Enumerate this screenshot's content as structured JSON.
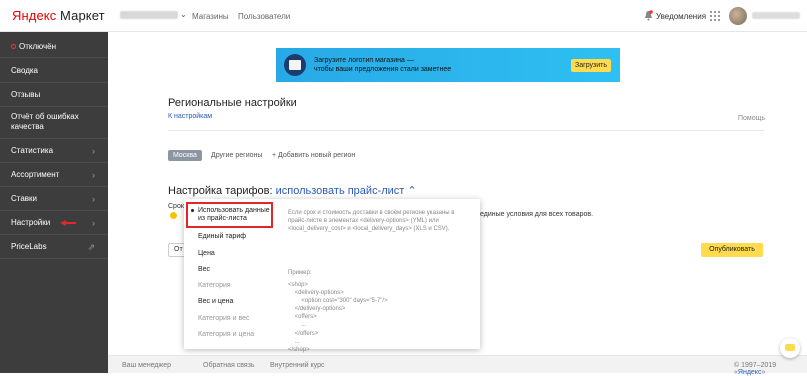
{
  "header": {
    "logo_brand": "Яндекс",
    "logo_product": "Маркет",
    "nav": [
      "Магазины",
      "Пользователи"
    ],
    "notifications_label": "Уведомления"
  },
  "sidebar": {
    "status_label": "Отключён",
    "items": [
      {
        "label": "Сводка",
        "chevron": false
      },
      {
        "label": "Отзывы",
        "chevron": false
      },
      {
        "label": "Отчёт об ошибках качества",
        "chevron": false
      },
      {
        "label": "Статистика",
        "chevron": true
      },
      {
        "label": "Ассортимент",
        "chevron": true
      },
      {
        "label": "Ставки",
        "chevron": true
      },
      {
        "label": "Настройки",
        "chevron": true
      },
      {
        "label": "PriceLabs",
        "chevron": false
      }
    ]
  },
  "banner": {
    "text_line1": "Загрузите логотип магазина —",
    "text_line2": "чтобы ваши предложения стали заметнее",
    "button_label": "Загрузить"
  },
  "page": {
    "title": "Региональные настройки",
    "back_link": "К настройкам",
    "help_link": "Помощь",
    "tabs": {
      "active": "Москва",
      "other": "Другие регионы",
      "add": "+ Добавить новый регион"
    },
    "tariff_title": "Настройка тарифов:",
    "tariff_value": "использовать прайс-лист",
    "tariff_chevron": "^",
    "bg_text_partial": "Срок",
    "bg_text_right": "единые условия для всех товаров.",
    "bg_button_partial": "От",
    "publish_button": "Опубликовать"
  },
  "dropdown": {
    "selected": "Использовать данные из прайс-листа",
    "items": [
      {
        "label": "Единый тариф",
        "disabled": false
      },
      {
        "label": "Цена",
        "disabled": false
      },
      {
        "label": "Вес",
        "disabled": false
      },
      {
        "label": "Категория",
        "disabled": true
      },
      {
        "label": "Вес и цена",
        "disabled": false
      },
      {
        "label": "Категория и вес",
        "disabled": true
      },
      {
        "label": "Категория и цена",
        "disabled": true
      }
    ],
    "description": "Если срок и стоимость доставки в своём регионе указаны в прайс-листе в элементах <delivery-options> (YML) или <local_delivery_cost> и <local_delivery_days> (XLS и CSV).",
    "example_label": "Пример:",
    "example_code": "<shop>\n    <delivery-options>\n        <option cost=\"300\" days=\"5-7\"/>\n    </delivery-options>\n    <offers>\n        ...\n    </offers>\n    ...\n</shop>"
  },
  "footer": {
    "links": [
      "Ваш менеджер",
      "Обратная связь",
      "Внутренний курс"
    ],
    "copyright_prefix": "© 1997–2019 «",
    "copyright_brand": "Яндекс",
    "copyright_suffix": "»"
  },
  "colors": {
    "sidebar_bg": "#3d3d3d",
    "accent_link": "#2b5bb5",
    "yellow_button": "#ffdb4d",
    "banner_blue": "#29b6f6",
    "highlight_red": "#e0282b"
  }
}
